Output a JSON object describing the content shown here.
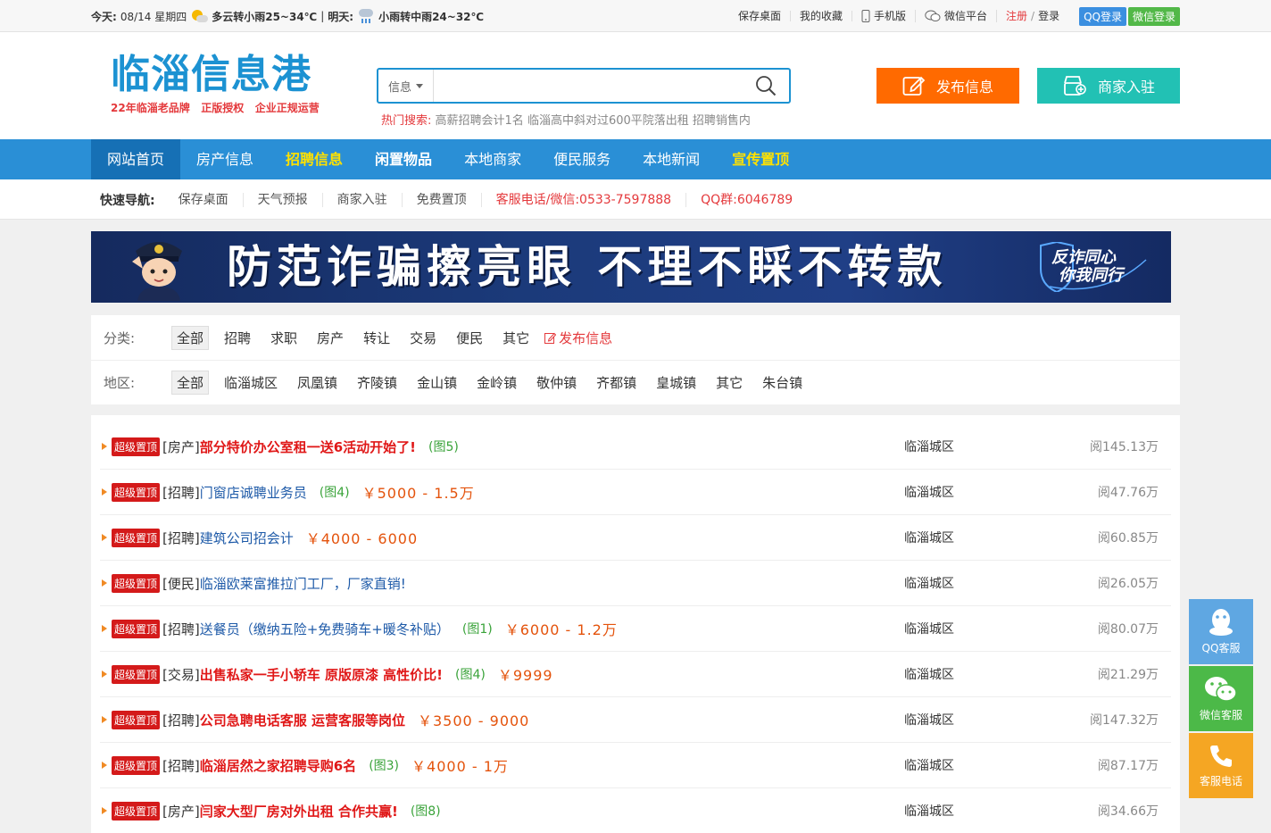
{
  "topbar": {
    "today_label": "今天:",
    "date": "08/14 星期四",
    "today_weather": "多云转小雨25~34℃",
    "tomorrow_label": "明天:",
    "tomorrow_weather": "小雨转中雨24~32℃",
    "links": [
      "保存桌面",
      "我的收藏",
      "手机版",
      "微信平台"
    ],
    "register": "注册",
    "sep": "/",
    "login": "登录",
    "qq_login": "QQ登录",
    "wechat_login": "微信登录"
  },
  "header": {
    "logo_title": "临淄信息港",
    "logo_slogan": "22年临淄老品牌   正版授权   企业正规运营",
    "search_category": "信息",
    "search_placeholder": "",
    "hot_label": "热门搜索:",
    "hot_keywords": [
      "高薪招聘会计1名",
      "临淄高中斜对过600平院落出租",
      "招聘销售内"
    ],
    "post_button": "发布信息",
    "merchant_button": "商家入驻"
  },
  "nav": {
    "items": [
      "网站首页",
      "房产信息",
      "招聘信息",
      "闲置物品",
      "本地商家",
      "便民服务",
      "本地新闻",
      "宣传置顶"
    ]
  },
  "quick": {
    "label": "快速导航:",
    "items": [
      "保存桌面",
      "天气预报",
      "商家入驻",
      "免费置顶"
    ],
    "phone": "客服电话/微信:0533-7597888",
    "qq_group": "QQ群:6046789"
  },
  "banner": {
    "text": "防范诈骗擦亮眼  不理不睬不转款",
    "badge_line1": "反诈同心",
    "badge_line2": "你我同行"
  },
  "filter": {
    "category_label": "分类:",
    "categories": [
      "全部",
      "招聘",
      "求职",
      "房产",
      "转让",
      "交易",
      "便民",
      "其它"
    ],
    "post_link": "发布信息",
    "region_label": "地区:",
    "regions": [
      "全部",
      "临淄城区",
      "凤凰镇",
      "齐陵镇",
      "金山镇",
      "金岭镇",
      "敬仲镇",
      "齐都镇",
      "皇城镇",
      "其它",
      "朱台镇"
    ]
  },
  "listings": [
    {
      "tag": "超级置顶",
      "category": "[房产]",
      "title": "部分特价办公室租一送6活动开始了!",
      "pics": "(图5)",
      "price": "",
      "area": "临淄城区",
      "views": "阅145.13万",
      "style": "red"
    },
    {
      "tag": "超级置顶",
      "category": "[招聘]",
      "title": "门窗店诚聘业务员",
      "pics": "(图4)",
      "price": "￥5000 - 1.5万",
      "area": "临淄城区",
      "views": "阅47.76万",
      "style": "blue"
    },
    {
      "tag": "超级置顶",
      "category": "[招聘]",
      "title": "建筑公司招会计",
      "pics": "",
      "price": "￥4000 - 6000",
      "area": "临淄城区",
      "views": "阅60.85万",
      "style": "blue"
    },
    {
      "tag": "超级置顶",
      "category": "[便民]",
      "title": "临淄欧莱富推拉门工厂，厂家直销!",
      "pics": "",
      "price": "",
      "area": "临淄城区",
      "views": "阅26.05万",
      "style": "blue"
    },
    {
      "tag": "超级置顶",
      "category": "[招聘]",
      "title": "送餐员（缴纳五险+免费骑车+暖冬补贴）",
      "pics": "(图1)",
      "price": "￥6000 - 1.2万",
      "area": "临淄城区",
      "views": "阅80.07万",
      "style": "blue"
    },
    {
      "tag": "超级置顶",
      "category": "[交易]",
      "title": "出售私家一手小轿车 原版原漆 高性价比!",
      "pics": "(图4)",
      "price": "￥9999",
      "area": "临淄城区",
      "views": "阅21.29万",
      "style": "red"
    },
    {
      "tag": "超级置顶",
      "category": "[招聘]",
      "title": "公司急聘电话客服 运营客服等岗位",
      "pics": "",
      "price": "￥3500 - 9000",
      "area": "临淄城区",
      "views": "阅147.32万",
      "style": "red"
    },
    {
      "tag": "超级置顶",
      "category": "[招聘]",
      "title": "临淄居然之家招聘导购6名",
      "pics": "(图3)",
      "price": "￥4000 - 1万",
      "area": "临淄城区",
      "views": "阅87.17万",
      "style": "red"
    },
    {
      "tag": "超级置顶",
      "category": "[房产]",
      "title": "闫家大型厂房对外出租 合作共赢!",
      "pics": "(图8)",
      "price": "",
      "area": "临淄城区",
      "views": "阅34.66万",
      "style": "red"
    }
  ],
  "float_service": {
    "qq": "QQ客服",
    "wechat": "微信客服",
    "phone": "客服电话"
  },
  "colors": {
    "brand_blue": "#2a8fd6",
    "post_orange": "#ff6a00",
    "merchant_teal": "#22c1b4",
    "accent_red": "#e4393c",
    "highlight_yellow": "#ffe100"
  }
}
